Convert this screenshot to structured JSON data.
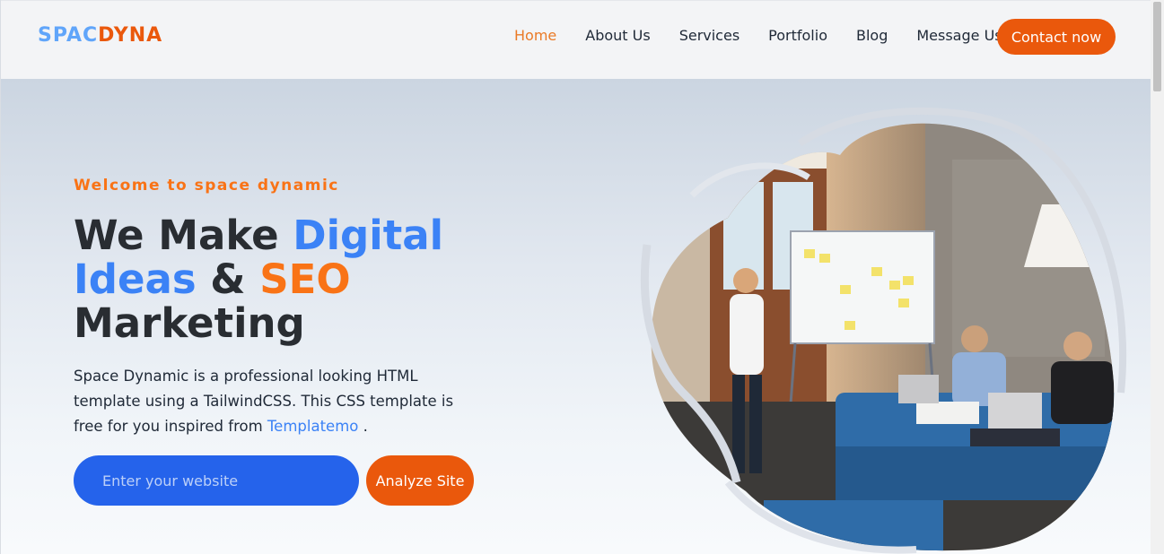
{
  "logo": {
    "part1": "SPAC",
    "part2": "DYNA"
  },
  "nav": {
    "items": [
      {
        "label": "Home",
        "active": true
      },
      {
        "label": "About Us"
      },
      {
        "label": "Services"
      },
      {
        "label": "Portfolio"
      },
      {
        "label": "Blog"
      },
      {
        "label": "Message Us"
      }
    ],
    "contact_label": "Contact now"
  },
  "hero": {
    "welcome": "Welcome to space dynamic",
    "headline": {
      "t1": "We Make ",
      "t2": "Digital",
      "t3": "Ideas",
      "t4": " & ",
      "t5": "SEO",
      "t6": "Marketing"
    },
    "description": {
      "text": "Space Dynamic is a professional looking HTML template using a TailwindCSS. This CSS template is free for you inspired from ",
      "link": "Templatemo",
      "end": " ."
    },
    "input_placeholder": "Enter your website",
    "analyze_label": "Analyze Site"
  },
  "colors": {
    "brand_orange": "#ea580c",
    "brand_blue": "#2563eb",
    "accent_light_blue": "#60a5fa"
  }
}
